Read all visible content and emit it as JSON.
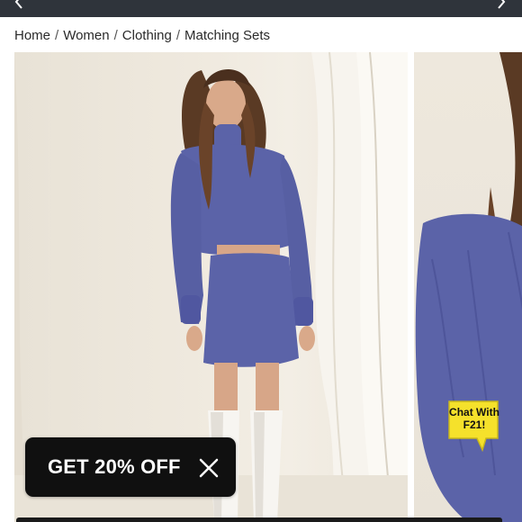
{
  "breadcrumb": {
    "items": [
      "Home",
      "Women",
      "Clothing",
      "Matching Sets"
    ],
    "separator": "/"
  },
  "promo": {
    "label": "GET 20% OFF",
    "close_icon": "close-icon"
  },
  "chat": {
    "label_line1": "Chat With",
    "label_line2": "F21!",
    "color": "#f5e12b"
  },
  "topbar": {
    "color": "#2f343b",
    "left_icon": "chevron-left-icon",
    "right_icon": "chevron-right-icon"
  },
  "product": {
    "garment_color": "#5b63a8",
    "images": [
      "model-front-photo",
      "model-side-photo"
    ]
  }
}
